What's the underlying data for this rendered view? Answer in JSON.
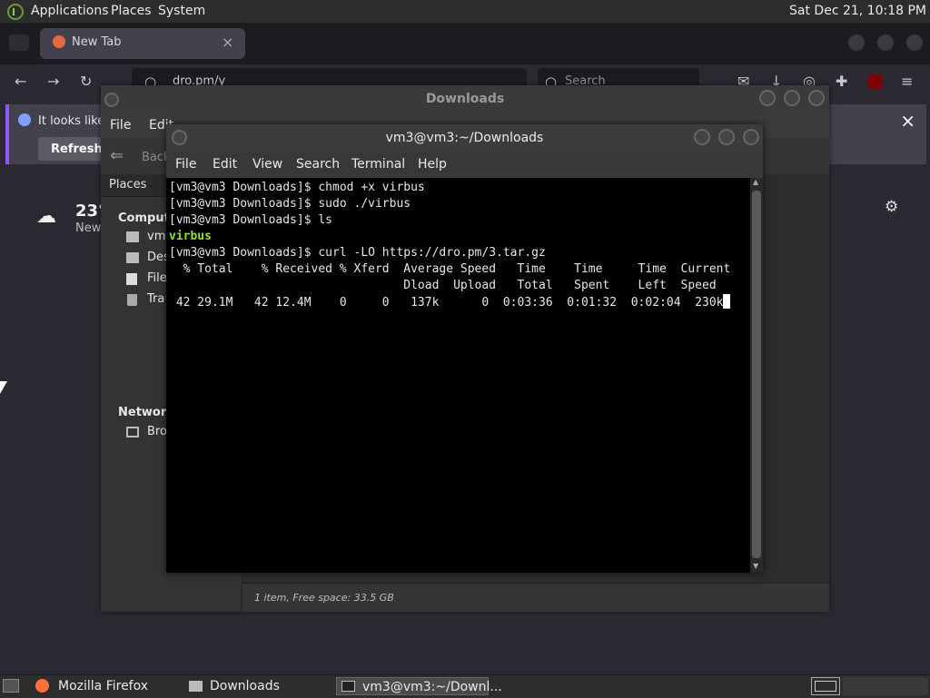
{
  "top_panel": {
    "menus": [
      "Applications",
      "Places",
      "System"
    ],
    "clock": "Sat Dec 21, 10:18 PM"
  },
  "firefox": {
    "tab_title": "New Tab",
    "tab_close": "×",
    "url_text": "dro.pm/y",
    "search_placeholder": "Search",
    "notice_text": "It looks like",
    "refresh_label": "Refresh F",
    "notice_close": "×",
    "weather_temp": "23°",
    "weather_place": "New"
  },
  "file_manager": {
    "title": "Downloads",
    "menus": [
      "File",
      "Edit"
    ],
    "back_label": "Back",
    "sidebar_header": "Places",
    "sidebar": {
      "computer": "Compute",
      "items_computer": [
        "vm3",
        "Des",
        "File",
        "Tra"
      ],
      "network": "Network",
      "items_network": [
        "Bro"
      ]
    },
    "status": "1 item, Free space: 33.5 GB"
  },
  "terminal": {
    "title": "vm3@vm3:~/Downloads",
    "menus": [
      "File",
      "Edit",
      "View",
      "Search",
      "Terminal",
      "Help"
    ],
    "lines": [
      "[vm3@vm3 Downloads]$ chmod +x virbus",
      "[vm3@vm3 Downloads]$ sudo ./virbus",
      "[vm3@vm3 Downloads]$ ls",
      "virbus",
      "[vm3@vm3 Downloads]$ curl -LO https://dro.pm/3.tar.gz",
      "  % Total    % Received % Xferd  Average Speed   Time    Time     Time  Current",
      "                                 Dload  Upload   Total   Spent    Left  Speed",
      " 42 29.1M   42 12.4M    0     0   137k      0  0:03:36  0:01:32  0:02:04  230k"
    ],
    "colored_line_index": 3
  },
  "taskbar": {
    "items": [
      "Mozilla Firefox",
      "Downloads",
      "vm3@vm3:~/Downl..."
    ],
    "active_index": 2
  },
  "colors": {
    "terminal_bg": "#000000",
    "terminal_text": "#e6e6e6",
    "exec_green": "#8ae234",
    "panel_bg": "#2d2d2d",
    "firefox_accent": "#9059ff"
  }
}
